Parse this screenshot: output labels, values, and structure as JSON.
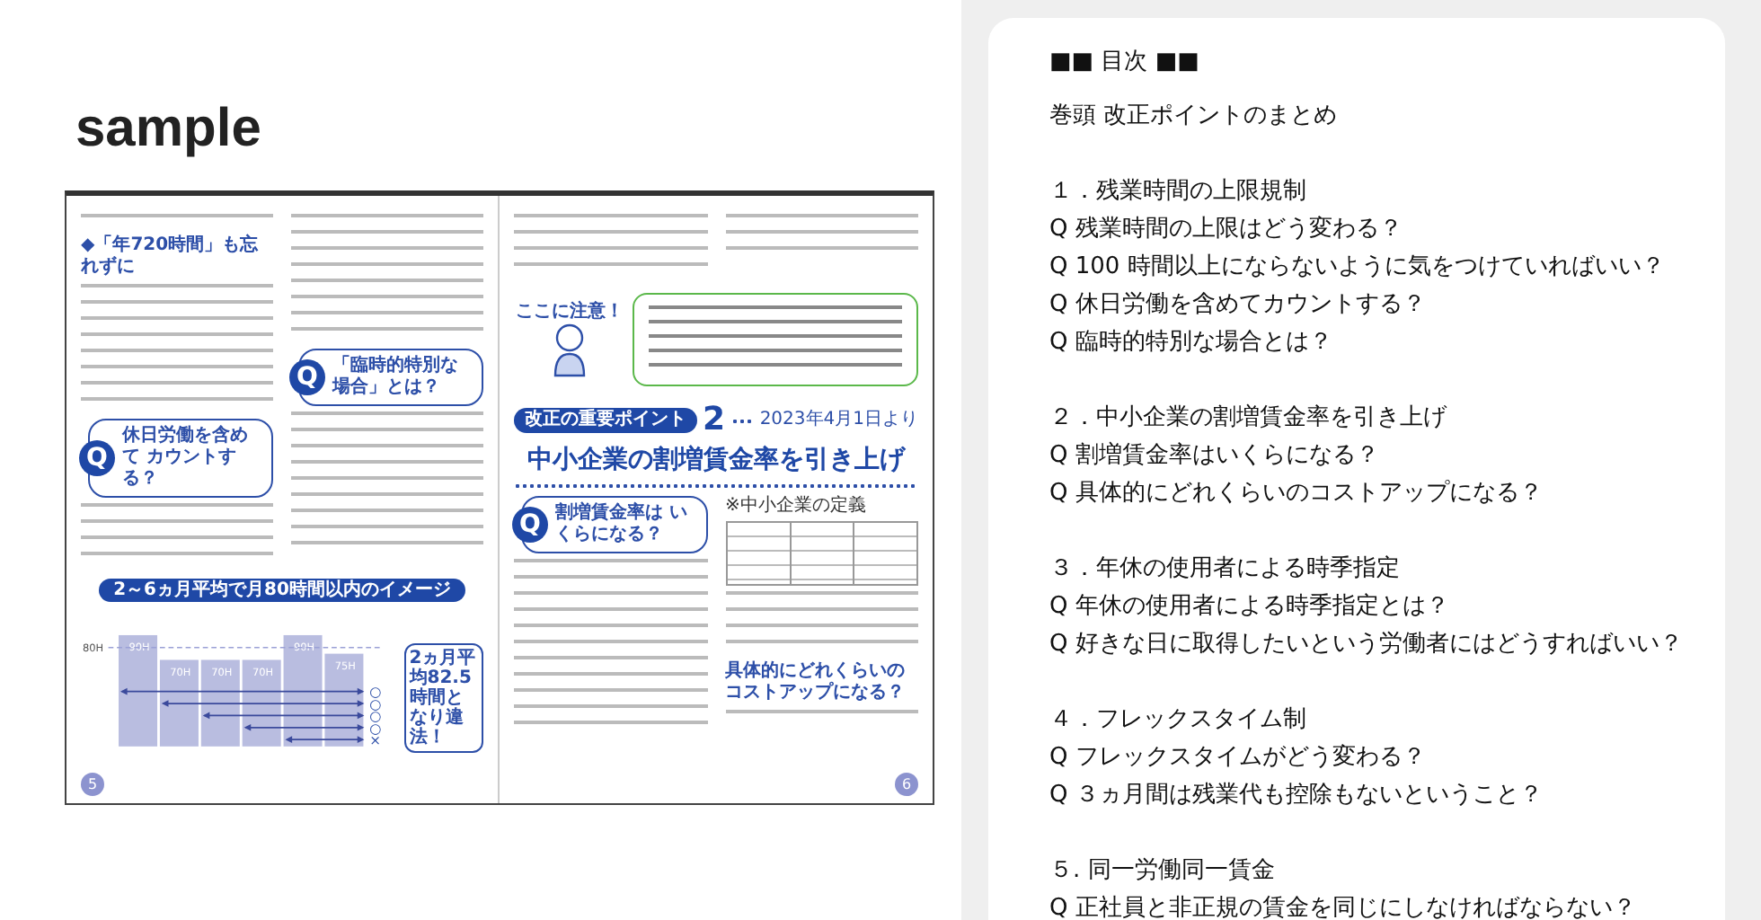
{
  "sample_label": "sample",
  "book": {
    "left_page": {
      "subheading": "◆「年720時間」も忘れずに",
      "questions": [
        {
          "badge": "Q",
          "text": "休日労働を含めて カウントする？"
        },
        {
          "badge": "Q",
          "text": "「臨時的特別な場合」とは？"
        }
      ],
      "chart_title": "2～6ヵ月平均で月80時間以内のイメージ",
      "chart_bar_labels": [
        "90H",
        "70H",
        "70H",
        "70H",
        "90H",
        "75H"
      ],
      "chart_line_label": "80H",
      "marks": [
        "○",
        "○",
        "○",
        "○",
        "×"
      ],
      "callout": "2ヵ月平均82.5時間となり違法！",
      "page_number": "5"
    },
    "right_page": {
      "attention_label": "ここに注意！",
      "point_label": "改正の重要ポイント",
      "point_number": "2",
      "effective_date": "2023年4月1日より",
      "title": "中小企業の割増賃金率を引き上げ",
      "question": {
        "badge": "Q",
        "text": "割増賃金率は いくらになる？"
      },
      "table_caption": "※中小企業の定義",
      "subheading": "具体的にどれくらいのコストアップになる？",
      "page_number": "6"
    }
  },
  "toc": {
    "title": "■■ 目次 ■■",
    "intro": "巻頭 改正ポイントのまとめ",
    "sections": [
      {
        "heading": "１．残業時間の上限規制",
        "questions": [
          "Q 残業時間の上限はどう変わる？",
          "Q 100 時間以上にならないように気をつけていればいい？",
          "Q 休日労働を含めてカウントする？",
          "Q 臨時的特別な場合とは？"
        ]
      },
      {
        "heading": "２．中小企業の割増賃金率を引き上げ",
        "questions": [
          "Q 割増賃金率はいくらになる？",
          "Q 具体的にどれくらいのコストアップになる？"
        ]
      },
      {
        "heading": "３．年休の使用者による時季指定",
        "questions": [
          "Q 年休の使用者による時季指定とは？",
          "Q 好きな日に取得したいという労働者にはどうすればいい？"
        ]
      },
      {
        "heading": "４．フレックスタイム制",
        "questions": [
          "Q フレックスタイムがどう変わる？",
          "Q ３ヵ月間は残業代も控除もないということ？"
        ]
      },
      {
        "heading": "５. 同一労働同一賃金",
        "questions": [
          "Q 正社員と非正規の賃金を同じにしなければならない？"
        ]
      }
    ]
  }
}
